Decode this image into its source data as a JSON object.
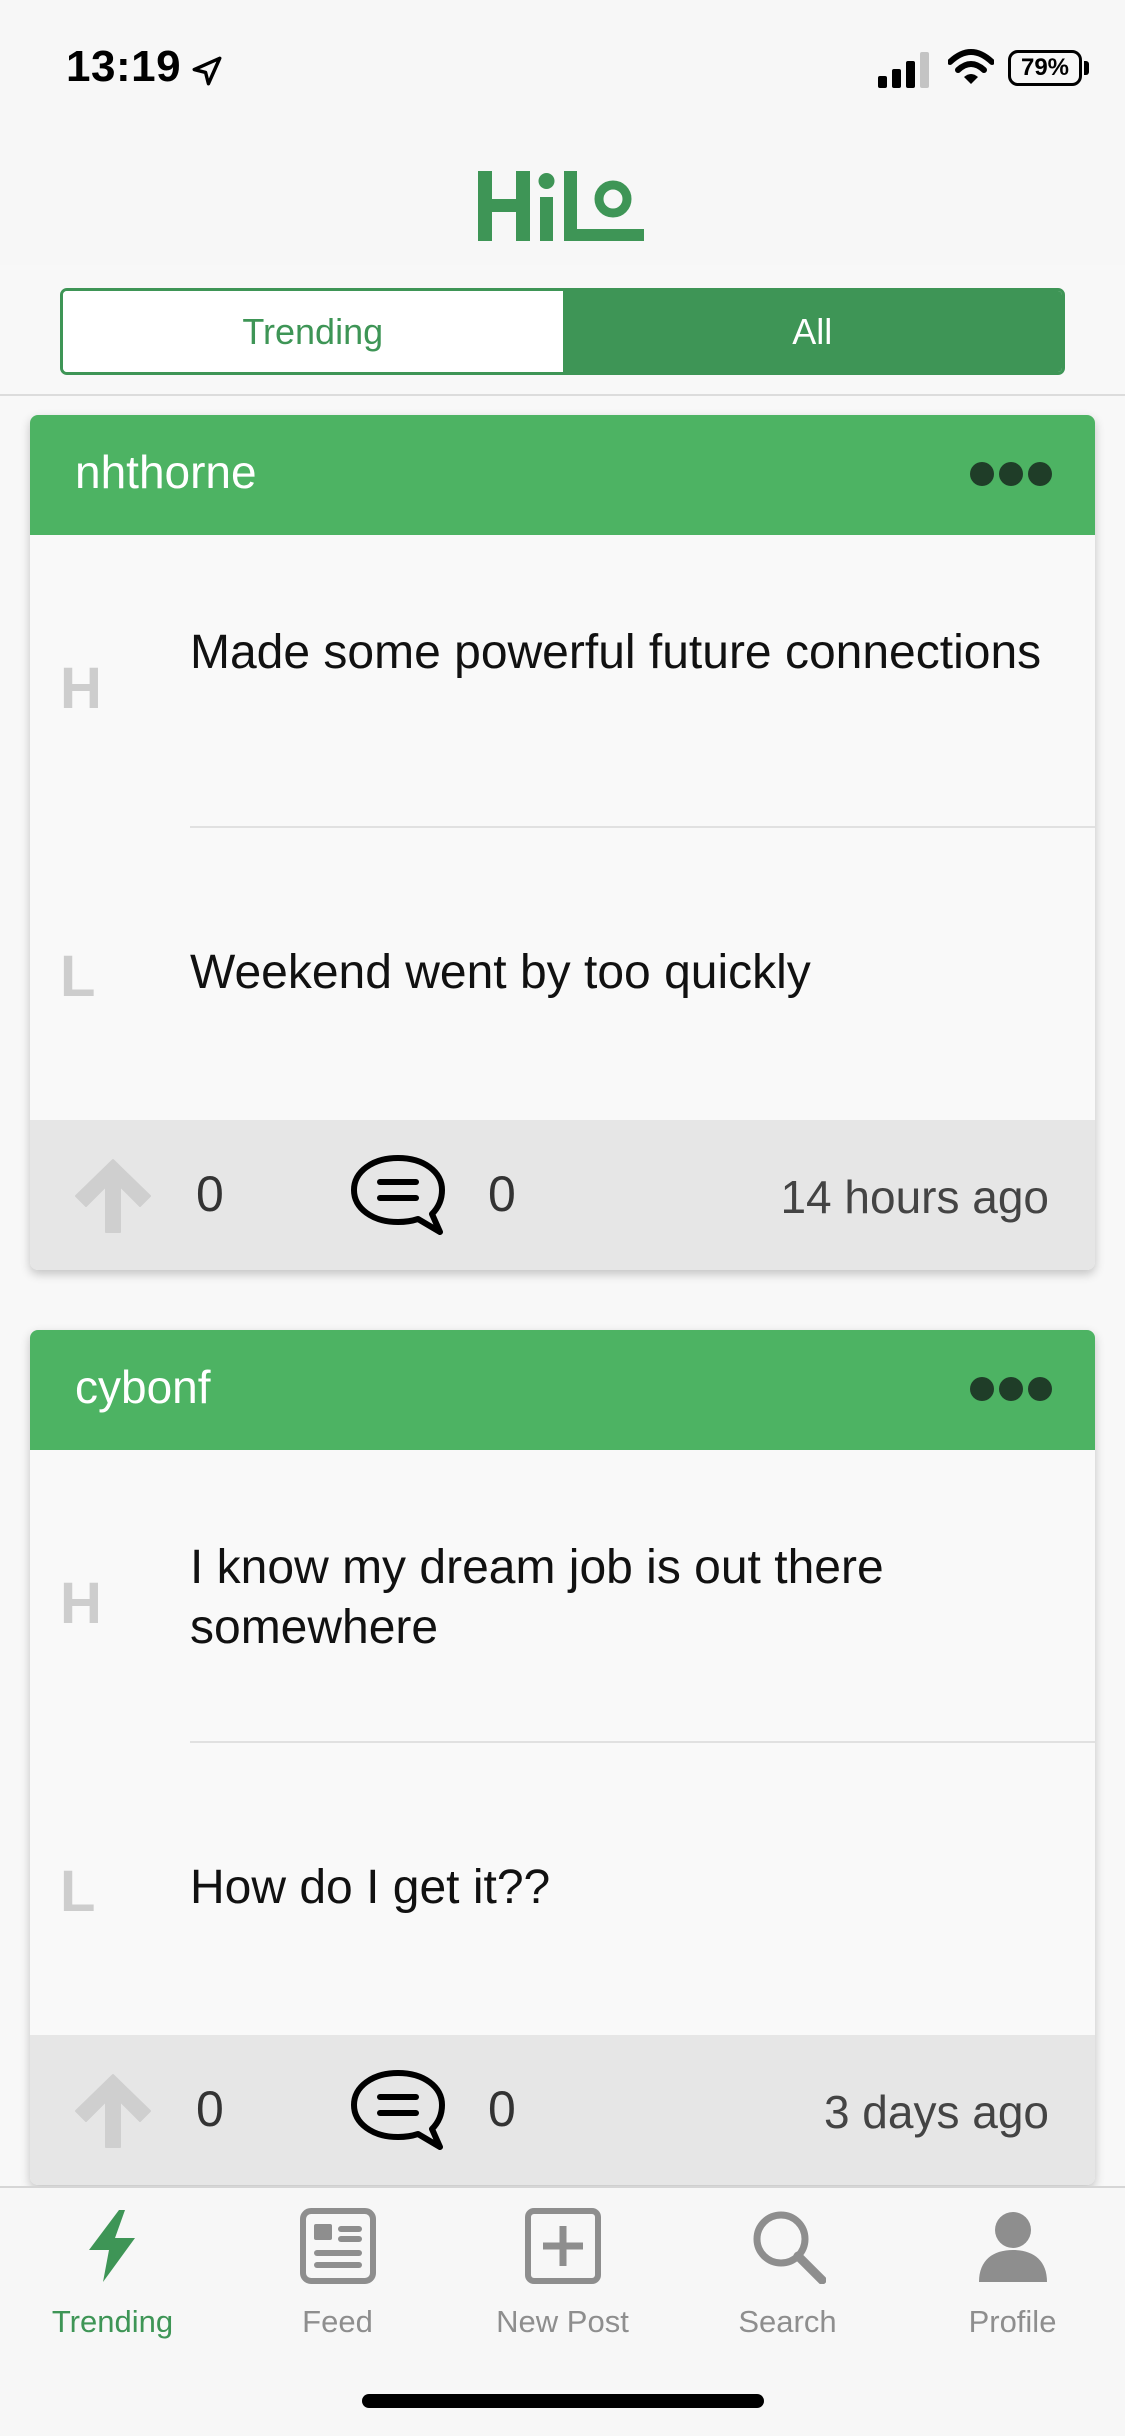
{
  "status_bar": {
    "time": "13:19",
    "battery": "79%"
  },
  "header": {
    "logo_text": "HiLo"
  },
  "segmented": {
    "trending_label": "Trending",
    "all_label": "All",
    "selected": "All"
  },
  "posts": [
    {
      "username": "nhthorne",
      "high_letter": "H",
      "high_text": "Made some powerful future connections",
      "low_letter": "L",
      "low_text": "Weekend went by too quickly",
      "upvotes": "0",
      "comments": "0",
      "time": "14 hours ago"
    },
    {
      "username": "cybonf",
      "high_letter": "H",
      "high_text": "I know my dream job is out there somewhere",
      "low_letter": "L",
      "low_text": "How do I get it??",
      "upvotes": "0",
      "comments": "0",
      "time": "3 days ago"
    }
  ],
  "tab_bar": {
    "items": [
      {
        "label": "Trending",
        "icon": "lightning-icon",
        "active": true
      },
      {
        "label": "Feed",
        "icon": "feed-icon",
        "active": false
      },
      {
        "label": "New Post",
        "icon": "plus-square-icon",
        "active": false
      },
      {
        "label": "Search",
        "icon": "search-icon",
        "active": false
      },
      {
        "label": "Profile",
        "icon": "profile-icon",
        "active": false
      }
    ]
  },
  "colors": {
    "brand_green": "#3e9556",
    "card_header_green": "#4db363",
    "inactive_gray": "#8e8e8e"
  }
}
